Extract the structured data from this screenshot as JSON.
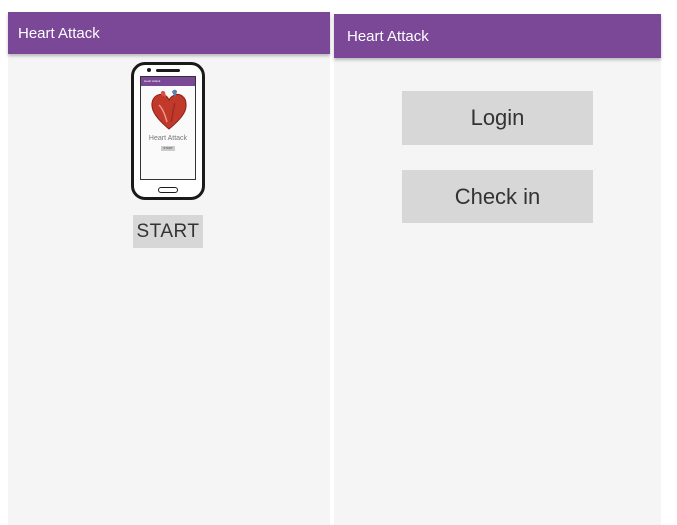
{
  "left_screen": {
    "app_title": "Heart Attack",
    "phone_illustration": {
      "mini_app_title": "Heart Attack",
      "mini_heading": "Heart Attack",
      "mini_button_label": "START",
      "icon": "heart-icon"
    },
    "start_label": "START"
  },
  "right_screen": {
    "app_title": "Heart Attack",
    "login_label": "Login",
    "checkin_label": "Check in"
  },
  "colors": {
    "action_bar": "#7b4797",
    "button_bg": "#d7d7d7",
    "screen_bg": "#f5f5f5"
  }
}
